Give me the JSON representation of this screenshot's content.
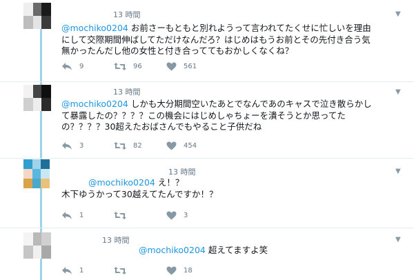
{
  "colors": {
    "mention": "#1b95e0",
    "thread_line": "#9fd3e8",
    "muted": "#657786",
    "divider": "#e6ecf0"
  },
  "tweets": [
    {
      "time": "13 時間",
      "mention": "@mochiko0204",
      "lines": [
        " お前さーもともと別れようって言われてたくせに忙しいを理由",
        "にして交際期間伸ばしてただけなんだろ？はじめはもうお前とその先付き合う気",
        "無かったんだし他の女性と付き合っててもおかしくなくね？"
      ],
      "replies": "9",
      "retweets": "96",
      "likes": "561"
    },
    {
      "time": "13 時間",
      "mention": "@mochiko0204",
      "lines": [
        " しかも大分期間空いたあとでなんであのキャスで泣き散らかし",
        "て暴露したの？？？？この機会にはじめしゃちょーを潰そうとか思ってた",
        "の？？？？30超えたおばさんでもやること子供だね"
      ],
      "replies": "3",
      "retweets": "82",
      "likes": "454"
    },
    {
      "time": "13 時間",
      "mention": "@mochiko0204",
      "lines": [
        " え！？",
        "木下ゆうかって30越えてたんですか！？"
      ],
      "replies": "1",
      "retweets": "",
      "likes": "3"
    },
    {
      "time": "13 時間",
      "mention": "@mochiko0204",
      "lines": [
        " 超えてますよ笑"
      ],
      "replies": "1",
      "retweets": "",
      "likes": "18"
    }
  ],
  "icons": [
    "reply-icon",
    "retweet-icon",
    "like-icon",
    "caret-down-icon"
  ]
}
